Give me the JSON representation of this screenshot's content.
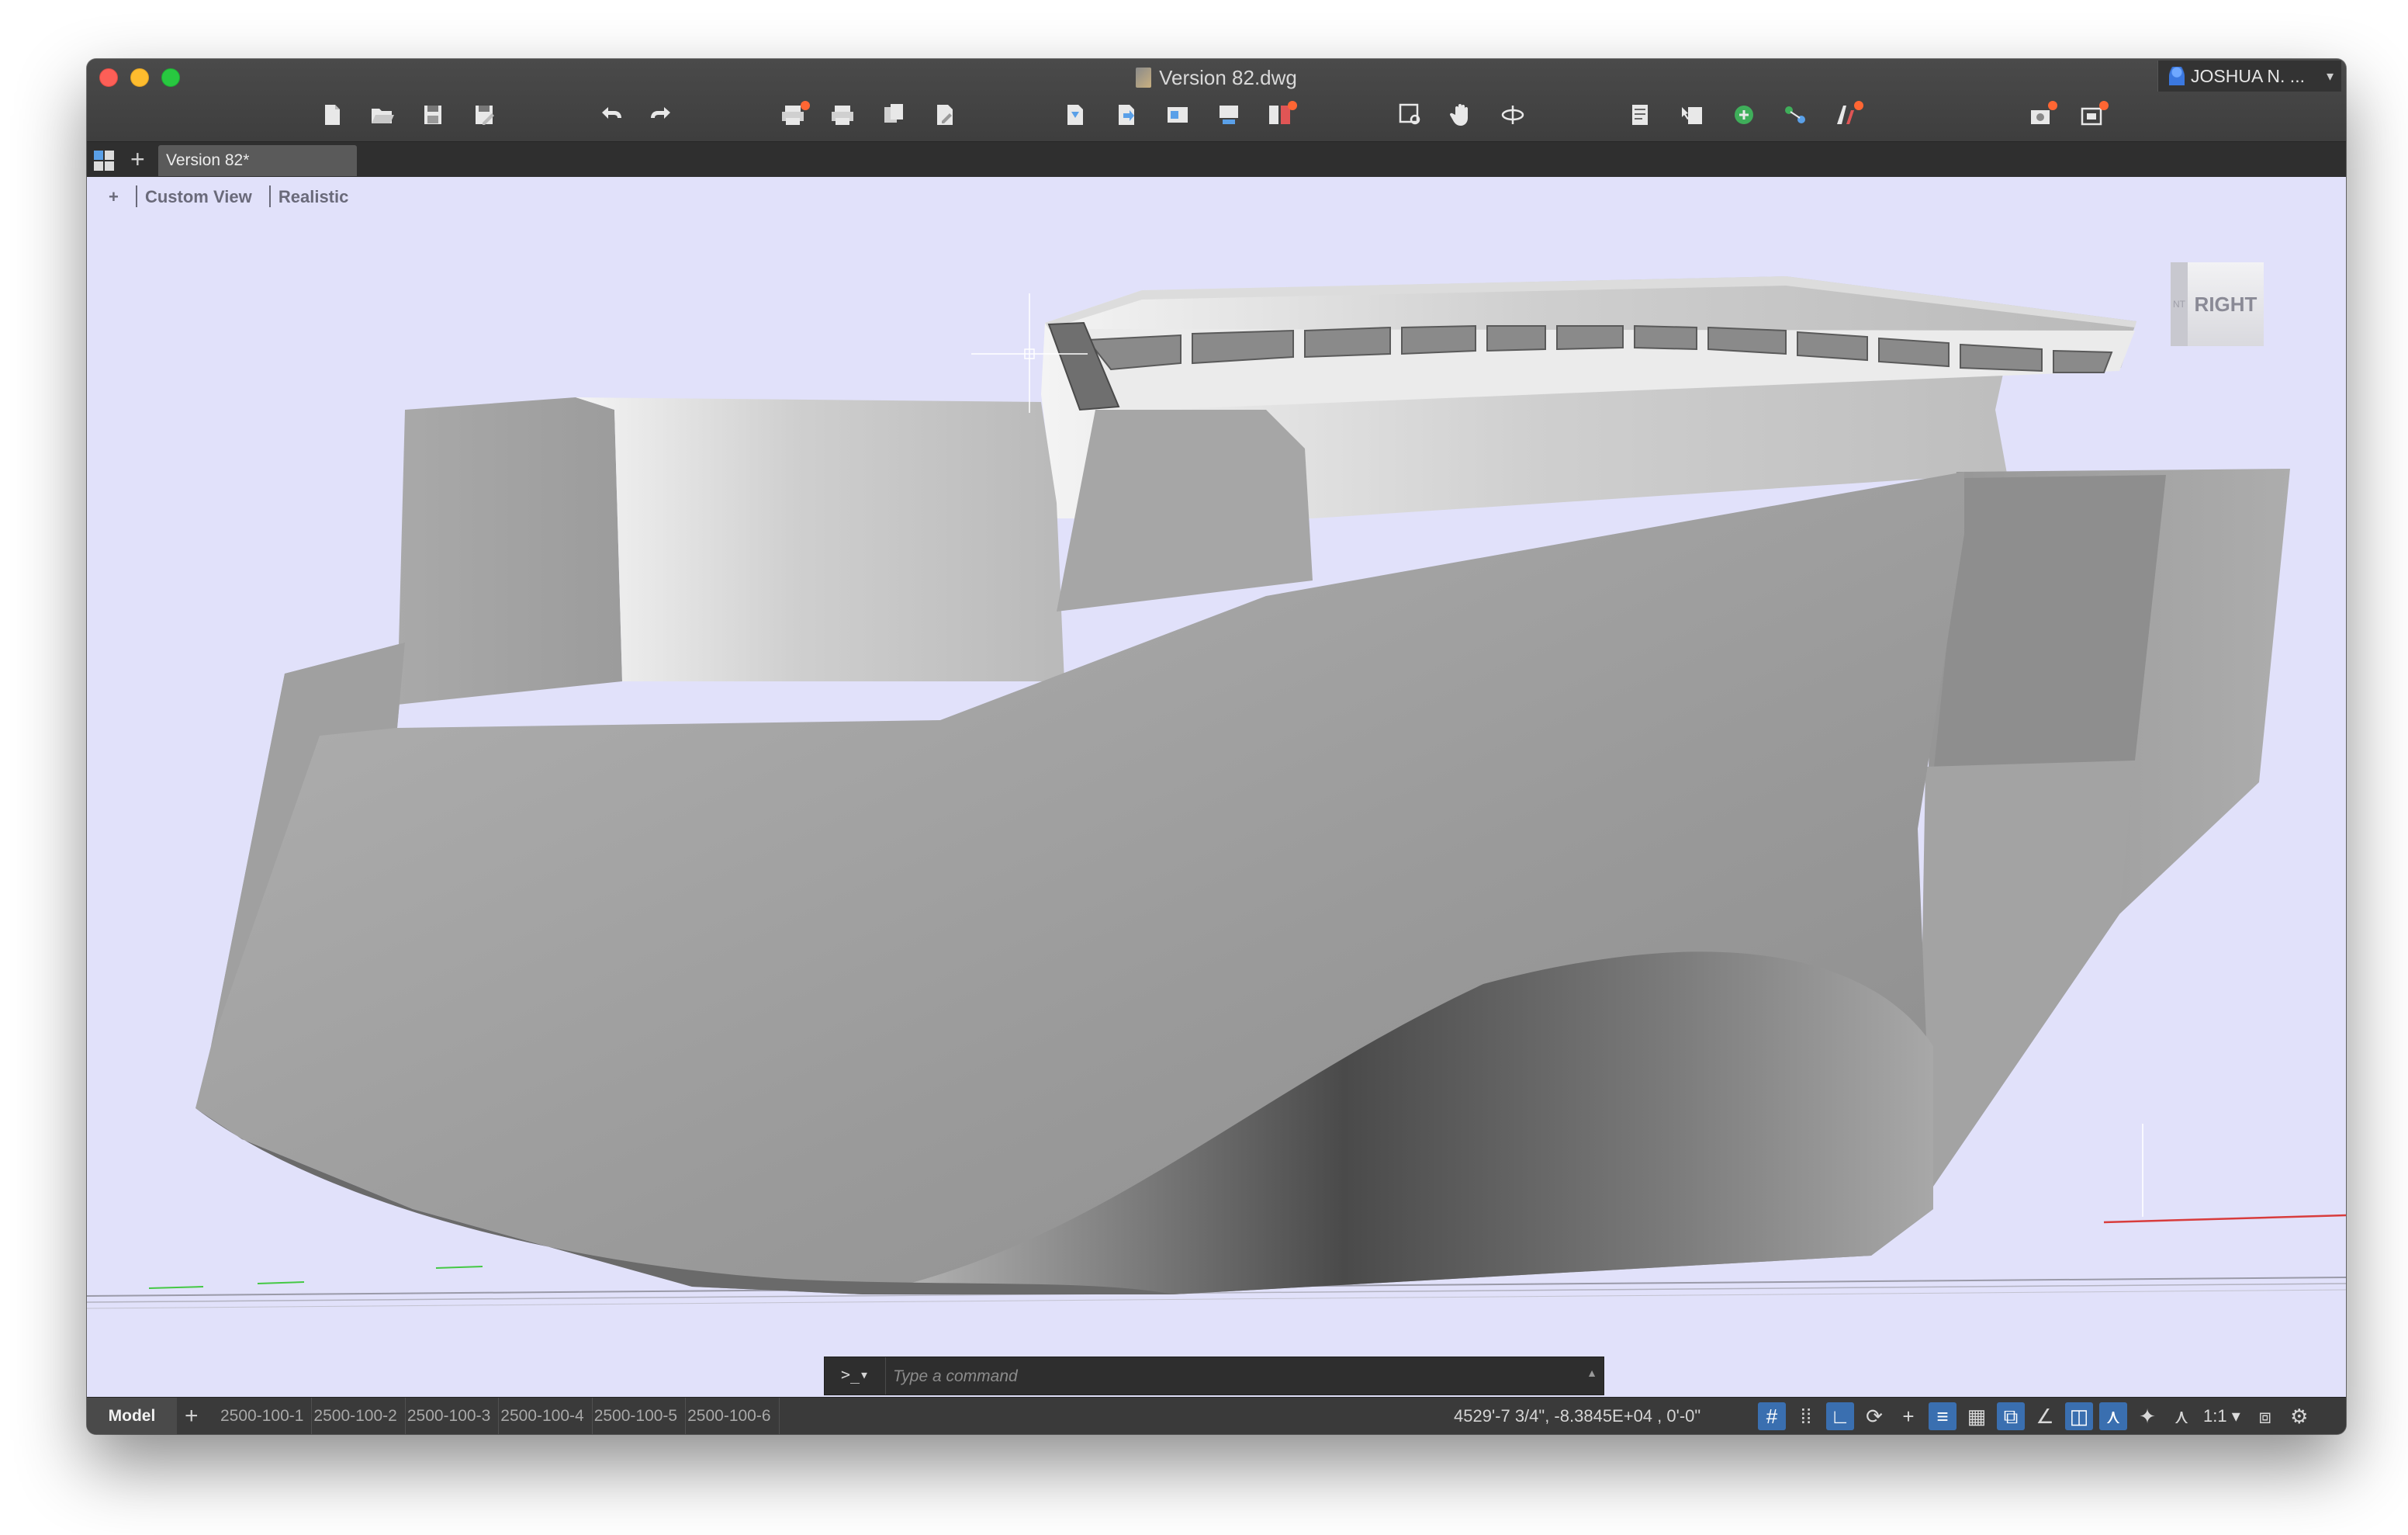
{
  "window": {
    "title": "Version 82.dwg",
    "user": "JOSHUA N. ..."
  },
  "toolbar": {
    "groups": [
      [
        "new-icon",
        "open-icon",
        "save-icon",
        "save-as-icon"
      ],
      [
        "undo-icon",
        "redo-icon"
      ],
      [
        "plot-icon",
        "print-icon",
        "page-setup-icon",
        "publish-icon"
      ],
      [
        "import-icon",
        "export-icon",
        "attach-icon",
        "etransmit-icon",
        "xref-icon"
      ],
      [
        "zoom-window-icon",
        "pan-icon",
        "orbit-icon"
      ],
      [
        "properties-icon",
        "match-icon",
        "layer-icon",
        "group-icon",
        "measure-icon"
      ],
      [
        "render-icon",
        "capture-icon"
      ]
    ]
  },
  "tabs": {
    "document_tab": "Version 82*"
  },
  "viewport": {
    "controls": {
      "plus": "+",
      "view": "Custom View",
      "visual_style": "Realistic"
    },
    "viewcube_label": "RIGHT",
    "background": "#e1e1fa"
  },
  "command": {
    "prompt": ">_▾",
    "placeholder": "Type a command"
  },
  "status": {
    "model_tab": "Model",
    "layouts": [
      "2500-100-1",
      "2500-100-2",
      "2500-100-3",
      "2500-100-4",
      "2500-100-5",
      "2500-100-6"
    ],
    "coordinates": "4529'-7 3/4\", -8.3845E+04 , 0'-0\"",
    "scale": "1:1 ▾",
    "toggles": [
      "grid-icon",
      "snap-icon",
      "ortho-icon",
      "polar-icon",
      "osnap-icon",
      "lineweight-icon",
      "transparency-icon",
      "selection-cycling-icon",
      "dynamic-ucs-icon",
      "annotation-monitor-icon",
      "units-icon",
      "annotation-visibility-icon",
      "auto-scale-icon",
      "workspace-icon",
      "settings-icon"
    ]
  },
  "colors": {
    "accent": "#3a6fb0",
    "close": "#fd5f57",
    "minimize": "#febc2e",
    "maximize": "#28c840",
    "notification": "#ff6633"
  }
}
